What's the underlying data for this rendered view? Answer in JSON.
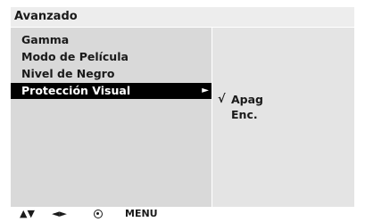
{
  "header": {
    "title": "Avanzado"
  },
  "menu": {
    "items": [
      {
        "label": "Gamma"
      },
      {
        "label": "Modo de Película"
      },
      {
        "label": "Nivel de Negro"
      },
      {
        "label": "Protección Visual",
        "arrow": "►"
      }
    ],
    "selected_index": 3
  },
  "submenu": {
    "check_mark": "√",
    "options": [
      {
        "label": "Apag",
        "checked": true
      },
      {
        "label": "Enc.",
        "checked": false
      }
    ]
  },
  "footer": {
    "updown": "▲▼",
    "leftright": "◄►",
    "ok_icon": "ok-circle-icon",
    "menu_label": "MENU"
  },
  "colors": {
    "title_bg": "#ededed",
    "left_panel_bg": "#d9d9d9",
    "right_panel_bg": "#e4e4e4",
    "selected_bg": "#000000",
    "selected_text": "#ffffff",
    "text": "#1a1a1a"
  }
}
